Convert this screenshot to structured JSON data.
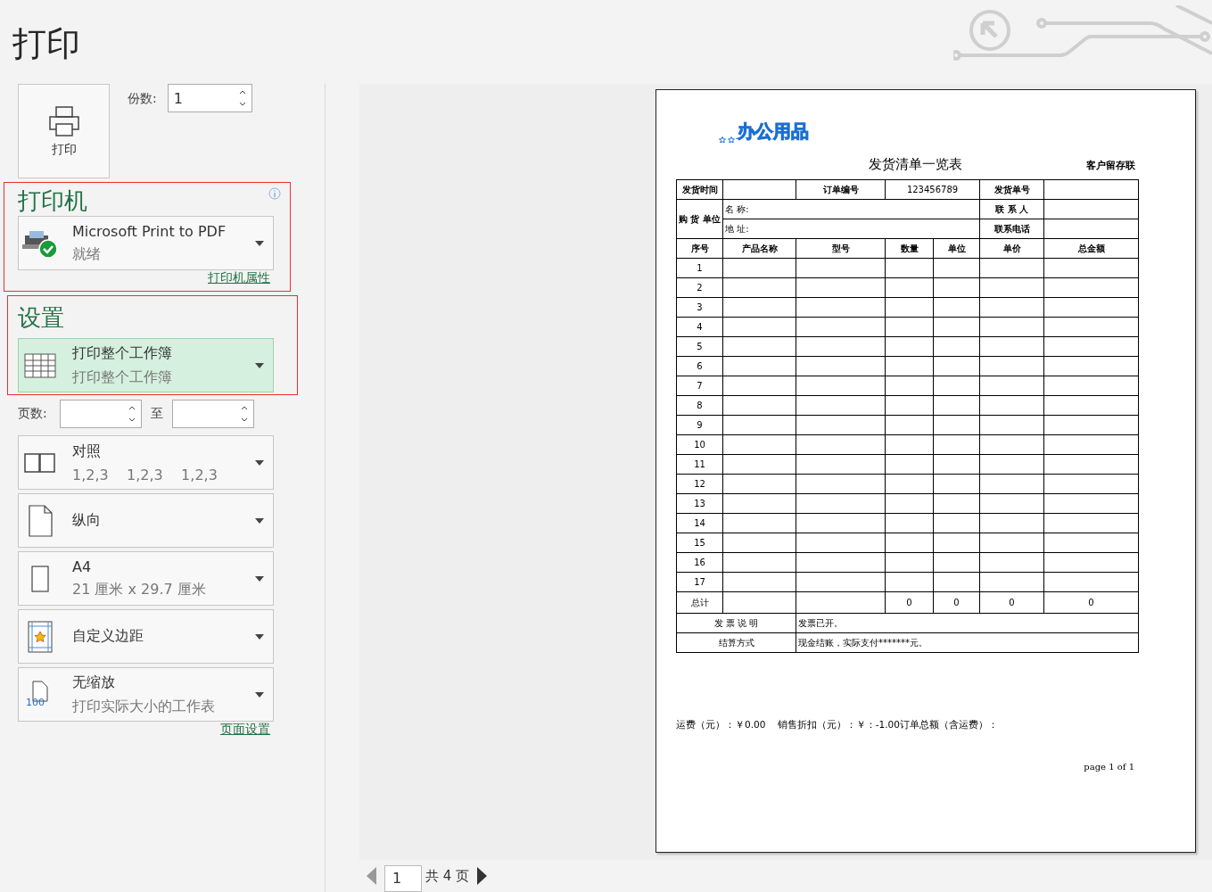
{
  "title": "打印",
  "print_button": {
    "label": "打印"
  },
  "copies": {
    "label": "份数:",
    "value": "1"
  },
  "printer": {
    "heading": "打印机",
    "annotated": true,
    "name": "Microsoft Print to PDF",
    "status": "就绪",
    "properties_link": "打印机属性"
  },
  "settings": {
    "heading": "设置",
    "annotated": true,
    "dropdowns": [
      {
        "kind": "sheets",
        "line1": "打印整个工作簿",
        "line2": "打印整个工作簿",
        "selected": true
      },
      {
        "kind": "pages"
      },
      {
        "kind": "collate",
        "line1": "对照",
        "line2": "1,2,3    1,2,3    1,2,3",
        "selected": false
      },
      {
        "kind": "orientation",
        "line1": "纵向",
        "selected": false
      },
      {
        "kind": "paper",
        "line1": "A4",
        "line2": "21 厘米 x 29.7 厘米",
        "selected": false
      },
      {
        "kind": "margins",
        "line1": "自定义边距",
        "selected": false
      },
      {
        "kind": "scaling",
        "icon_text": "100",
        "line1": "无缩放",
        "line2": "打印实际大小的工作表",
        "selected": false
      }
    ],
    "pages": {
      "label": "页数:",
      "to": "至"
    },
    "page_setup_link": "页面设置"
  },
  "document": {
    "logo": "办公用品",
    "title": "发货清单一览表",
    "copy_label": "客户留存联",
    "info": {
      "ship_time_label": "发货时间",
      "order_no_label": "订单编号",
      "order_no": "123456789",
      "ship_no_label": "发货单号",
      "buyer_label": "购 货  单位",
      "name_label": "名 称:",
      "contact_label": "联 系 人",
      "address_label": "地 址:",
      "phone_label": "联系电话"
    },
    "columns": [
      "序号",
      "产品名称",
      "型号",
      "数量",
      "单位",
      "单价",
      "总金额"
    ],
    "rows": [
      "1",
      "2",
      "3",
      "4",
      "5",
      "6",
      "7",
      "8",
      "9",
      "10",
      "11",
      "12",
      "13",
      "14",
      "15",
      "16",
      "17"
    ],
    "total_row": {
      "label": "总计",
      "values": [
        "0",
        "0",
        "0",
        "0"
      ]
    },
    "notes": [
      {
        "label": "发 票 说 明",
        "text": "发票已开。"
      },
      {
        "label": "结算方式",
        "text": "现金结账，实际支付*******元。"
      }
    ],
    "footer_line": "运费（元）：￥0.00    销售折扣（元）：￥：-1.00订单总额（含运费）：",
    "page_number": "page 1 of 1"
  },
  "navigation": {
    "page": "1",
    "total": "共 4 页"
  }
}
